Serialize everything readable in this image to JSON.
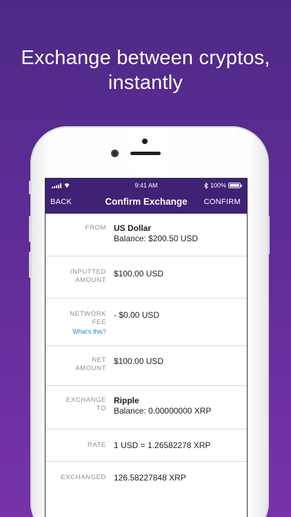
{
  "headline": {
    "line1": "Exchange between cryptos,",
    "line2": "instantly"
  },
  "status_bar": {
    "time": "9:41 AM",
    "battery": "100%"
  },
  "nav": {
    "back": "BACK",
    "title": "Confirm Exchange",
    "confirm": "CONFIRM"
  },
  "rows": {
    "from": {
      "label": "FROM",
      "currency": "US Dollar",
      "balance": "Balance: $200.50 USD"
    },
    "inputted": {
      "label1": "INPUTTED",
      "label2": "AMOUNT",
      "value": "$100.00 USD"
    },
    "fee": {
      "label1": "NETWORK",
      "label2": "FEE",
      "help": "What's this?",
      "value": "- $0.00 USD"
    },
    "net": {
      "label1": "NET",
      "label2": "AMOUNT",
      "value": "$100.00 USD"
    },
    "exchange_to": {
      "label1": "EXCHANGE",
      "label2": "TO",
      "currency": "Ripple",
      "balance": "Balance: 0.00000000 XRP"
    },
    "rate": {
      "label": "RATE",
      "value": "1 USD = 1.26582278 XRP"
    },
    "exchanged": {
      "label": "EXCHANGED",
      "value": "126.58227848 XRP"
    }
  },
  "icons": {
    "signal": "cellular-signal-icon",
    "wifi": "wifi-icon",
    "bluetooth": "bluetooth-icon",
    "battery": "battery-icon"
  },
  "colors": {
    "background_top": "#4e2a86",
    "background_bottom": "#7733a9",
    "nav_bar": "#3f2275",
    "link": "#2c7fc1",
    "label": "#8e8e93"
  }
}
